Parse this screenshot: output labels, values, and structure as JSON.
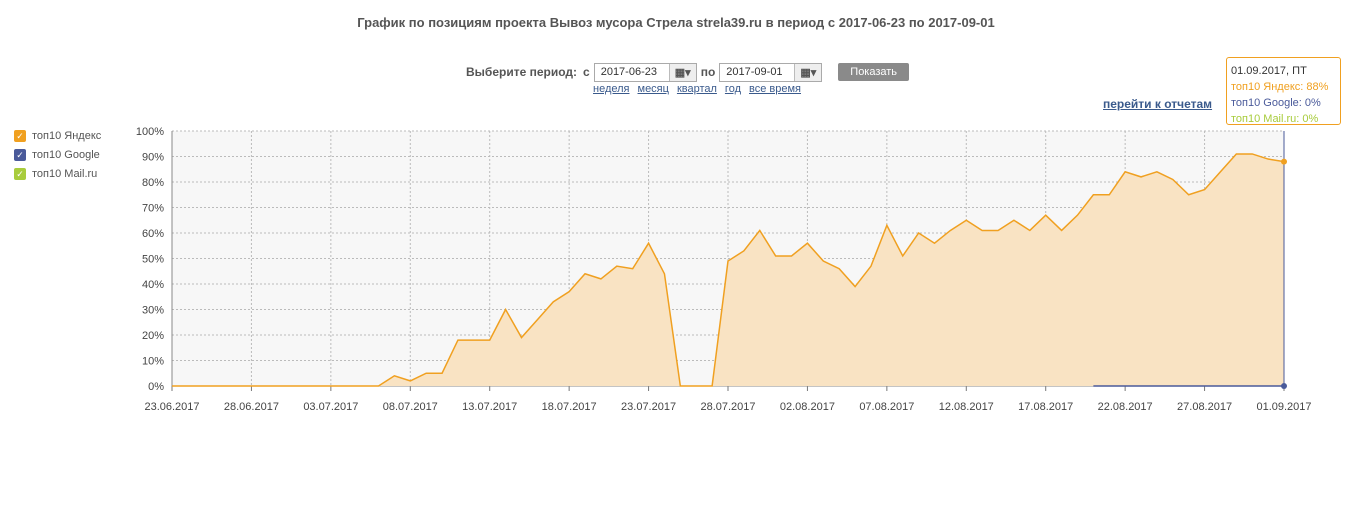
{
  "header": {
    "title": "График по позициям проекта Вывоз мусора Стрела strela39.ru в период с 2017-06-23 по 2017-09-01"
  },
  "period": {
    "label": "Выберите период:",
    "from_label": "с",
    "from_value": "2017-06-23",
    "to_label": "по",
    "to_value": "2017-09-01",
    "show_button": "Показать",
    "presets": [
      "неделя",
      "месяц",
      "квартал",
      "год",
      "все время"
    ]
  },
  "reports_link": "перейти к отчетам",
  "icons": {
    "calendar": "calendar-icon",
    "dropdown": "chevron-down-icon",
    "check": "check-icon"
  },
  "tooltip": {
    "date": "01.09.2017, ПТ",
    "yandex": "топ10 Яндекс: 88%",
    "google": "топ10 Google: 0%",
    "mail": "топ10 Mail.ru: 0%"
  },
  "legend": [
    {
      "name": "топ10 Яндекс",
      "color": "#f0a020"
    },
    {
      "name": "топ10 Google",
      "color": "#4a5a9a"
    },
    {
      "name": "топ10 Mail.ru",
      "color": "#a8cc3c"
    }
  ],
  "chart_data": {
    "type": "area",
    "x_start": "2017-06-23",
    "x_end": "2017-09-01",
    "x_tick_labels": [
      "23.06.2017",
      "28.06.2017",
      "03.07.2017",
      "08.07.2017",
      "13.07.2017",
      "18.07.2017",
      "23.07.2017",
      "28.07.2017",
      "02.08.2017",
      "07.08.2017",
      "12.08.2017",
      "17.08.2017",
      "22.08.2017",
      "27.08.2017",
      "01.09.2017"
    ],
    "y_tick_labels": [
      "0%",
      "10%",
      "20%",
      "30%",
      "40%",
      "50%",
      "60%",
      "70%",
      "80%",
      "90%",
      "100%"
    ],
    "ylim": [
      0,
      100
    ],
    "grid": true,
    "colors": {
      "area_fill": "#f9e3c3",
      "yandex": "#f0a020",
      "google": "#4a5a9a",
      "mail": "#a8cc3c"
    },
    "series": [
      {
        "name": "топ10 Яндекс",
        "points": [
          [
            "2017-06-23",
            0
          ],
          [
            "2017-06-24",
            0
          ],
          [
            "2017-06-25",
            0
          ],
          [
            "2017-06-26",
            0
          ],
          [
            "2017-06-27",
            0
          ],
          [
            "2017-06-28",
            0
          ],
          [
            "2017-06-29",
            0
          ],
          [
            "2017-06-30",
            0
          ],
          [
            "2017-07-01",
            0
          ],
          [
            "2017-07-02",
            0
          ],
          [
            "2017-07-03",
            0
          ],
          [
            "2017-07-04",
            0
          ],
          [
            "2017-07-05",
            0
          ],
          [
            "2017-07-06",
            0
          ],
          [
            "2017-07-07",
            4
          ],
          [
            "2017-07-08",
            2
          ],
          [
            "2017-07-09",
            5
          ],
          [
            "2017-07-10",
            5
          ],
          [
            "2017-07-11",
            18
          ],
          [
            "2017-07-12",
            18
          ],
          [
            "2017-07-13",
            18
          ],
          [
            "2017-07-14",
            30
          ],
          [
            "2017-07-15",
            19
          ],
          [
            "2017-07-16",
            26
          ],
          [
            "2017-07-17",
            33
          ],
          [
            "2017-07-18",
            37
          ],
          [
            "2017-07-19",
            44
          ],
          [
            "2017-07-20",
            42
          ],
          [
            "2017-07-21",
            47
          ],
          [
            "2017-07-22",
            46
          ],
          [
            "2017-07-23",
            56
          ],
          [
            "2017-07-24",
            44
          ],
          [
            "2017-07-25",
            0
          ],
          [
            "2017-07-26",
            0
          ],
          [
            "2017-07-27",
            0
          ],
          [
            "2017-07-28",
            49
          ],
          [
            "2017-07-29",
            53
          ],
          [
            "2017-07-30",
            61
          ],
          [
            "2017-07-31",
            51
          ],
          [
            "2017-08-01",
            51
          ],
          [
            "2017-08-02",
            56
          ],
          [
            "2017-08-03",
            49
          ],
          [
            "2017-08-04",
            46
          ],
          [
            "2017-08-05",
            39
          ],
          [
            "2017-08-06",
            47
          ],
          [
            "2017-08-07",
            63
          ],
          [
            "2017-08-08",
            51
          ],
          [
            "2017-08-09",
            60
          ],
          [
            "2017-08-10",
            56
          ],
          [
            "2017-08-11",
            61
          ],
          [
            "2017-08-12",
            65
          ],
          [
            "2017-08-13",
            61
          ],
          [
            "2017-08-14",
            61
          ],
          [
            "2017-08-15",
            65
          ],
          [
            "2017-08-16",
            61
          ],
          [
            "2017-08-17",
            67
          ],
          [
            "2017-08-18",
            61
          ],
          [
            "2017-08-19",
            67
          ],
          [
            "2017-08-20",
            75
          ],
          [
            "2017-08-21",
            75
          ],
          [
            "2017-08-22",
            84
          ],
          [
            "2017-08-23",
            82
          ],
          [
            "2017-08-24",
            84
          ],
          [
            "2017-08-25",
            81
          ],
          [
            "2017-08-26",
            75
          ],
          [
            "2017-08-27",
            77
          ],
          [
            "2017-08-28",
            84
          ],
          [
            "2017-08-29",
            91
          ],
          [
            "2017-08-30",
            91
          ],
          [
            "2017-08-31",
            89
          ],
          [
            "2017-09-01",
            88
          ]
        ]
      },
      {
        "name": "топ10 Google",
        "points": [
          [
            "2017-08-20",
            0
          ],
          [
            "2017-09-01",
            0
          ]
        ]
      },
      {
        "name": "топ10 Mail.ru",
        "points": []
      }
    ]
  }
}
